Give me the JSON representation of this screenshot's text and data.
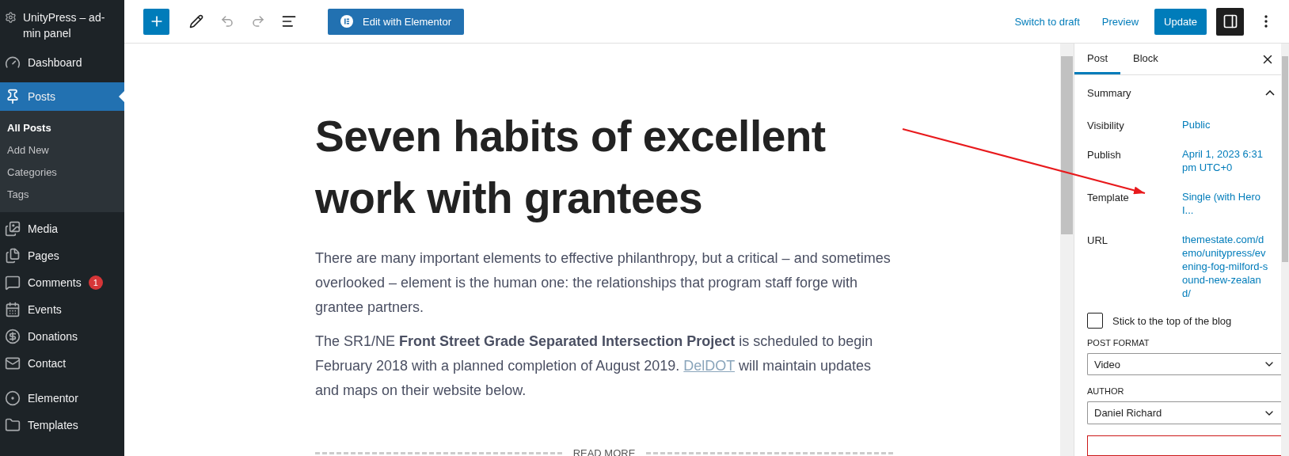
{
  "site_title": "UnityPress – ad-min panel",
  "menu": [
    {
      "label": "Dashboard",
      "selected": false
    },
    {
      "label": "Posts",
      "selected": true,
      "children": [
        {
          "label": "All Posts",
          "selected": true
        },
        {
          "label": "Add New",
          "selected": false
        },
        {
          "label": "Categories",
          "selected": false
        },
        {
          "label": "Tags",
          "selected": false
        }
      ]
    },
    {
      "label": "Media",
      "selected": false
    },
    {
      "label": "Pages",
      "selected": false
    },
    {
      "label": "Comments",
      "selected": false,
      "badge": "1"
    },
    {
      "label": "Events",
      "selected": false
    },
    {
      "label": "Donations",
      "selected": false
    },
    {
      "label": "Contact",
      "selected": false
    },
    {
      "label": "Elementor",
      "selected": false
    },
    {
      "label": "Templates",
      "selected": false
    }
  ],
  "toolbar": {
    "elementor_button": "Edit with Elementor",
    "switch_to_draft": "Switch to draft",
    "preview": "Preview",
    "update": "Update"
  },
  "post": {
    "title": "Seven habits of excellent work with grantees",
    "paragraphs": [
      {
        "text": " There are many important elements to effective philanthropy, but a critical – and sometimes overlooked – element is the human one: the relationships that program staff forge with grantee partners."
      },
      {
        "text": "The SR1/NE **Front Street Grade Separated Intersection Project** is scheduled to begin February 2018 with a planned completion of August 2019. ",
        "link": "DelDOT",
        "after": " will maintain updates and maps on their website below."
      }
    ],
    "read_more": "READ MORE"
  },
  "panel": {
    "tabs": [
      {
        "label": "Post",
        "selected": true
      },
      {
        "label": "Block",
        "selected": false
      }
    ],
    "summary": {
      "title": "Summary",
      "expanded": true
    },
    "rows": [
      {
        "label": "Visibility",
        "value": "Public"
      },
      {
        "label": "Publish",
        "value": "April 1, 2023 6:31 pm UTC+0"
      },
      {
        "label": "Template",
        "value": "Single (with Hero I..."
      },
      {
        "label": "URL",
        "value": "themestate.com/demo/unitypress/evening-fog-milford-sound-new-zealand/"
      }
    ],
    "sticky": {
      "label": "Stick to the top of the blog",
      "checked": false
    },
    "post_format": {
      "label": "POST FORMAT",
      "value": "Video"
    },
    "author": {
      "label": "AUTHOR",
      "value": "Daniel Richard"
    }
  }
}
